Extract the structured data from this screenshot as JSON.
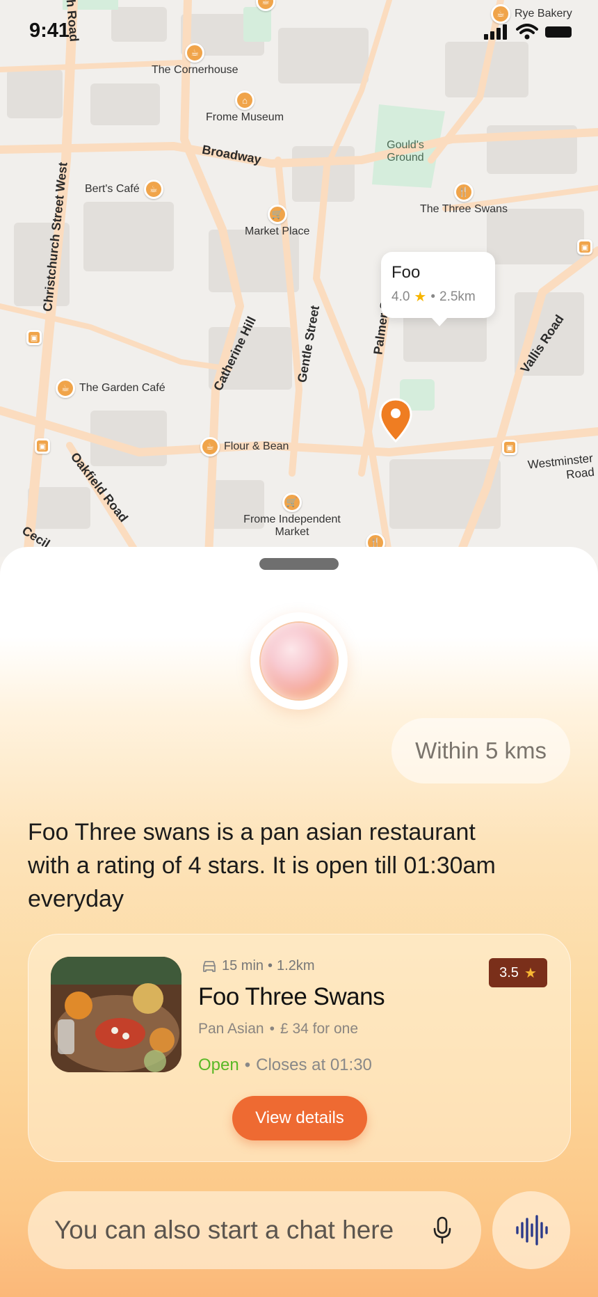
{
  "status_bar": {
    "time": "9:41"
  },
  "map": {
    "roads": [
      {
        "name": "Broadway"
      },
      {
        "name": "Christchurch Street West"
      },
      {
        "name": "Catherine Hill"
      },
      {
        "name": "Gentle Street"
      },
      {
        "name": "Palmer St"
      },
      {
        "name": "Vallis Road"
      },
      {
        "name": "Oakfield Road"
      },
      {
        "name": "Westminster Road"
      },
      {
        "name": "th Road"
      },
      {
        "name": "Cecil"
      }
    ],
    "places": [
      {
        "name": "The Cornerhouse",
        "icon": "cup-icon"
      },
      {
        "name": "Frome Museum",
        "icon": "museum-icon"
      },
      {
        "name": "Gould's Ground",
        "icon": ""
      },
      {
        "name": "Bert's Café",
        "icon": "cup-icon"
      },
      {
        "name": "The Three Swans",
        "icon": "utensils-icon"
      },
      {
        "name": "Market Place",
        "icon": "cart-icon"
      },
      {
        "name": "The Garden Café",
        "icon": "cup-icon"
      },
      {
        "name": "Flour & Bean",
        "icon": "cup-icon"
      },
      {
        "name": "Frome Independent Market",
        "icon": "cart-icon"
      },
      {
        "name": "Rye Bakery",
        "icon": "cup-icon"
      }
    ],
    "callout": {
      "title": "Foo",
      "rating": "4.0",
      "distance": "2.5km"
    },
    "accent_color": "#ef7d22"
  },
  "sheet": {
    "user_message": "Within 5 kms",
    "assistant_message": "Foo Three swans is a pan asian restaurant with a rating of 4 stars. It is open till 01:30am everyday",
    "result": {
      "travel_time": "15 min",
      "distance": "1.2km",
      "name": "Foo Three Swans",
      "cuisine": "Pan Asian",
      "price": "£ 34 for one",
      "status": "Open",
      "closes": "Closes at 01:30",
      "rating": "3.5",
      "button": "View details"
    },
    "chat": {
      "placeholder": "You can also start a chat here"
    },
    "colors": {
      "button": "#ee6a32",
      "open": "#59b826",
      "rating_badge": "#7a2f1a"
    }
  }
}
